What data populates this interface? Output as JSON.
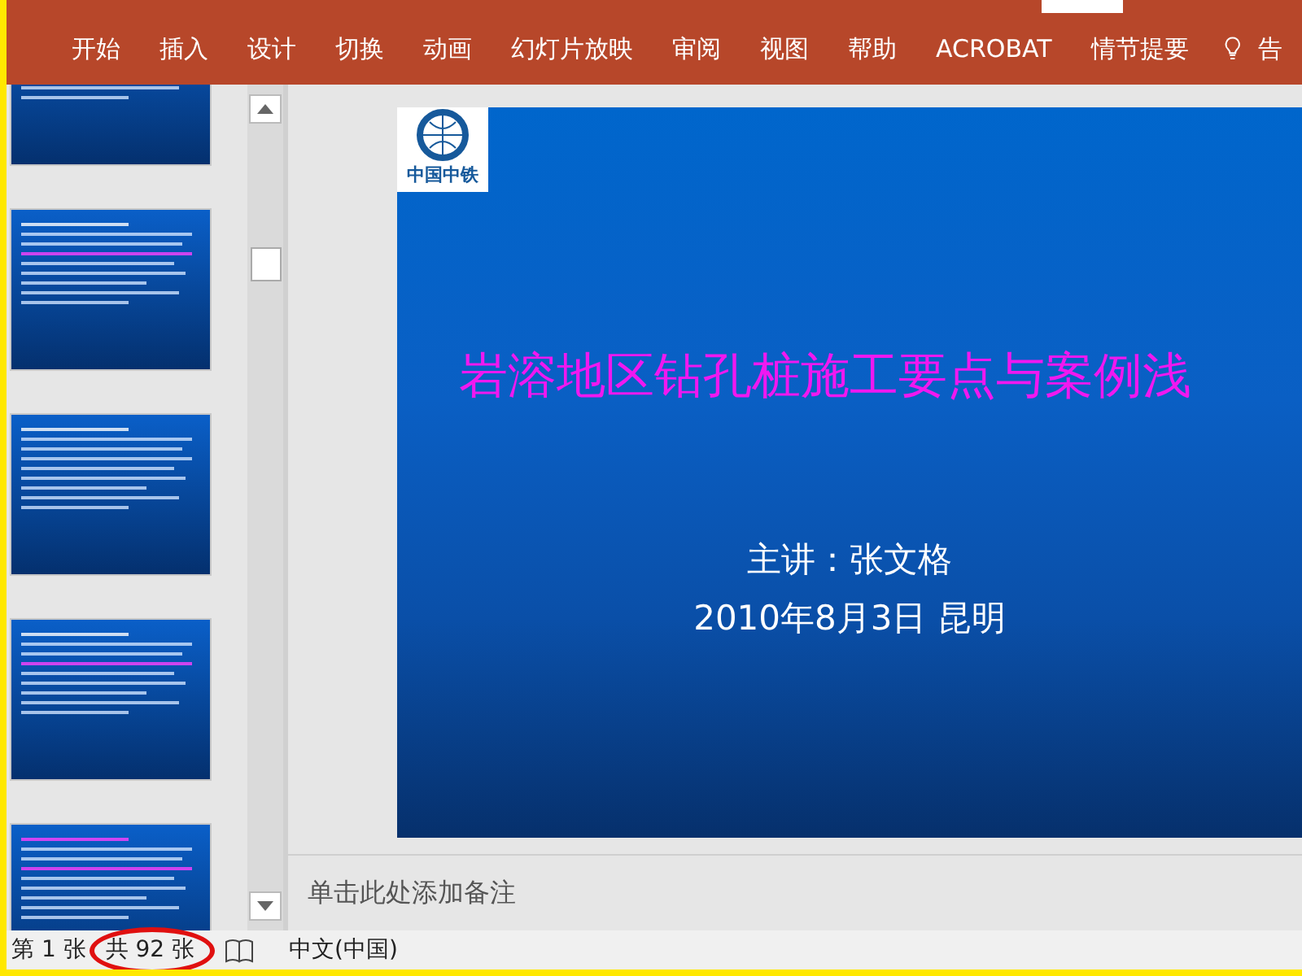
{
  "ribbon": {
    "tabs": [
      "开始",
      "插入",
      "设计",
      "切换",
      "动画",
      "幻灯片放映",
      "审阅",
      "视图",
      "帮助",
      "ACROBAT",
      "情节提要"
    ],
    "tell_me": "告"
  },
  "slide": {
    "logo_text": "中国中铁",
    "title": "岩溶地区钻孔桩施工要点与案例浅",
    "presenter": "主讲：张文格",
    "date": "2010年8月3日 昆明"
  },
  "notes": {
    "placeholder": "单击此处添加备注"
  },
  "status_bar": {
    "slide": "第 1 张",
    "total": "共 92 张",
    "total_circled": true,
    "language": "中文(中国)"
  }
}
